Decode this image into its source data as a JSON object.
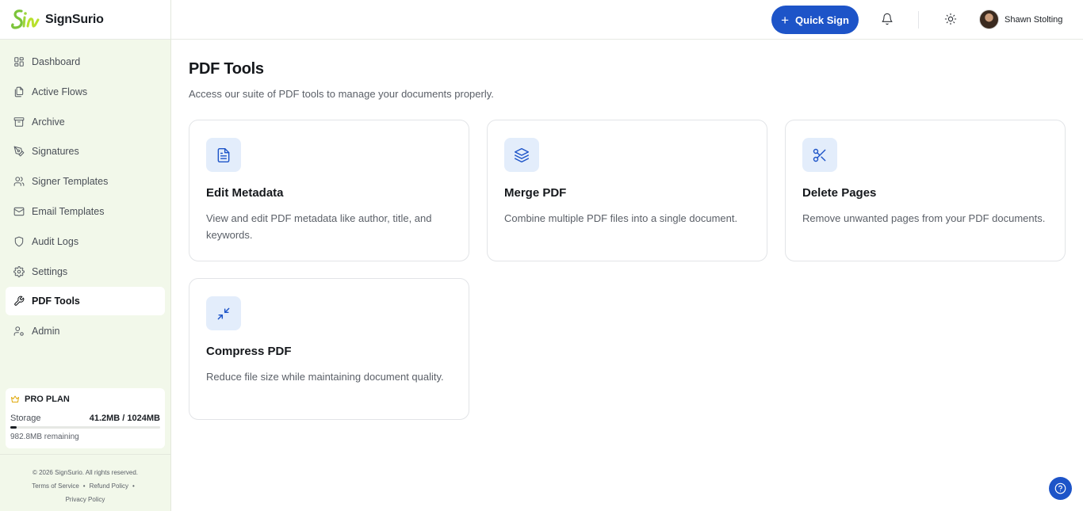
{
  "brand": {
    "name": "SignSurio"
  },
  "sidebar": {
    "items": [
      {
        "label": "Dashboard",
        "icon": "dashboard-icon"
      },
      {
        "label": "Active Flows",
        "icon": "files-icon"
      },
      {
        "label": "Archive",
        "icon": "archive-icon"
      },
      {
        "label": "Signatures",
        "icon": "pen-icon"
      },
      {
        "label": "Signer Templates",
        "icon": "users-icon"
      },
      {
        "label": "Email Templates",
        "icon": "mail-icon"
      },
      {
        "label": "Audit Logs",
        "icon": "shield-icon"
      },
      {
        "label": "Settings",
        "icon": "gear-icon"
      },
      {
        "label": "PDF Tools",
        "icon": "wrench-icon",
        "active": true
      },
      {
        "label": "Admin",
        "icon": "user-cog-icon"
      }
    ]
  },
  "plan": {
    "name": "PRO PLAN",
    "storage_label": "Storage",
    "storage_value": "41.2MB / 1024MB",
    "used_fraction": 0.0402,
    "remaining": "982.8MB remaining"
  },
  "footer": {
    "copyright": "© 2026 SignSurio. All rights reserved.",
    "terms": "Terms of Service",
    "refund": "Refund Policy",
    "privacy": "Privacy Policy",
    "separator": "•"
  },
  "header": {
    "quick_sign_label": "Quick Sign",
    "user_name": "Shawn Stolting"
  },
  "main": {
    "title": "PDF Tools",
    "subtitle": "Access our suite of PDF tools to manage your documents properly.",
    "tools": [
      {
        "title": "Edit Metadata",
        "description": "View and edit PDF metadata like author, title, and keywords.",
        "icon": "file-text-icon"
      },
      {
        "title": "Merge PDF",
        "description": "Combine multiple PDF files into a single document.",
        "icon": "layers-icon"
      },
      {
        "title": "Delete Pages",
        "description": "Remove unwanted pages from your PDF documents.",
        "icon": "scissors-icon"
      },
      {
        "title": "Compress PDF",
        "description": "Reduce file size while maintaining document quality.",
        "icon": "minimize-icon"
      }
    ]
  },
  "colors": {
    "accent": "#1d54c8",
    "sidebar_bg": "#f2f8ea",
    "icon_tile_bg": "#e3edfb"
  }
}
